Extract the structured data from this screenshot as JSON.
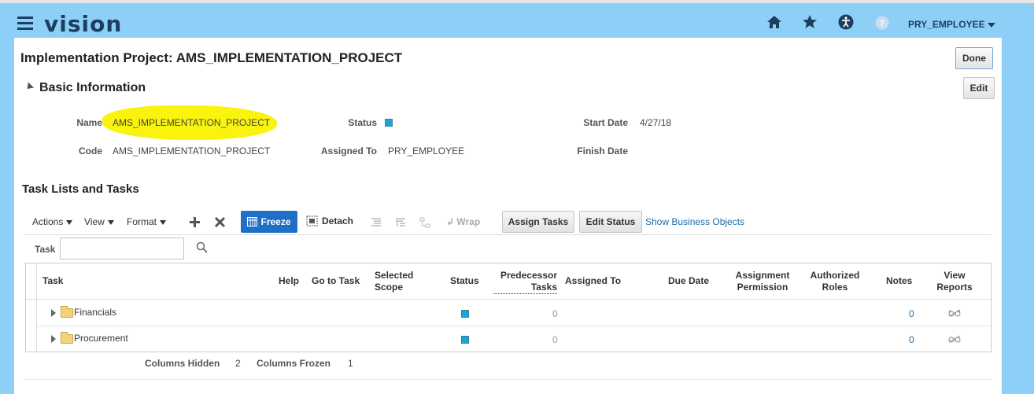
{
  "header": {
    "logo": "vision",
    "user": "PRY_EMPLOYEE",
    "icons": [
      "home-icon",
      "favorites-star-icon",
      "accessibility-icon",
      "help-icon"
    ]
  },
  "page": {
    "title": "Implementation Project: AMS_IMPLEMENTATION_PROJECT",
    "done_label": "Done",
    "edit_label": "Edit"
  },
  "basic_info": {
    "heading": "Basic Information",
    "name_label": "Name",
    "name_value": "AMS_IMPLEMENTATION_PROJECT",
    "code_label": "Code",
    "code_value": "AMS_IMPLEMENTATION_PROJECT",
    "status_label": "Status",
    "assigned_label": "Assigned To",
    "assigned_value": "PRY_EMPLOYEE",
    "start_label": "Start Date",
    "start_value": "4/27/18",
    "finish_label": "Finish Date",
    "status_color": "#1aa6d4",
    "highlight_color": "#f9f200"
  },
  "tasks": {
    "heading": "Task Lists and Tasks",
    "toolbar": {
      "actions": "Actions",
      "view": "View",
      "format": "Format",
      "freeze": "Freeze",
      "detach": "Detach",
      "wrap": "Wrap",
      "assign_tasks": "Assign Tasks",
      "edit_status": "Edit Status",
      "show_business_objects": "Show Business Objects"
    },
    "search_label": "Task",
    "columns": {
      "task": "Task",
      "help": "Help",
      "go_to_task": "Go to Task",
      "selected_scope_1": "Selected",
      "selected_scope_2": "Scope",
      "status": "Status",
      "predecessor_1": "Predecessor",
      "predecessor_2": "Tasks",
      "assigned_to": "Assigned To",
      "due_date": "Due Date",
      "assignment_1": "Assignment",
      "assignment_2": "Permission",
      "authorized_1": "Authorized",
      "authorized_2": "Roles",
      "notes": "Notes",
      "view_reports_1": "View",
      "view_reports_2": "Reports"
    },
    "rows": [
      {
        "name": "Financials",
        "predecessor": "0",
        "notes": "0"
      },
      {
        "name": "Procurement",
        "predecessor": "0",
        "notes": "0"
      }
    ],
    "footer": {
      "hidden_label": "Columns Hidden",
      "hidden_value": "2",
      "frozen_label": "Columns Frozen",
      "frozen_value": "1"
    }
  }
}
